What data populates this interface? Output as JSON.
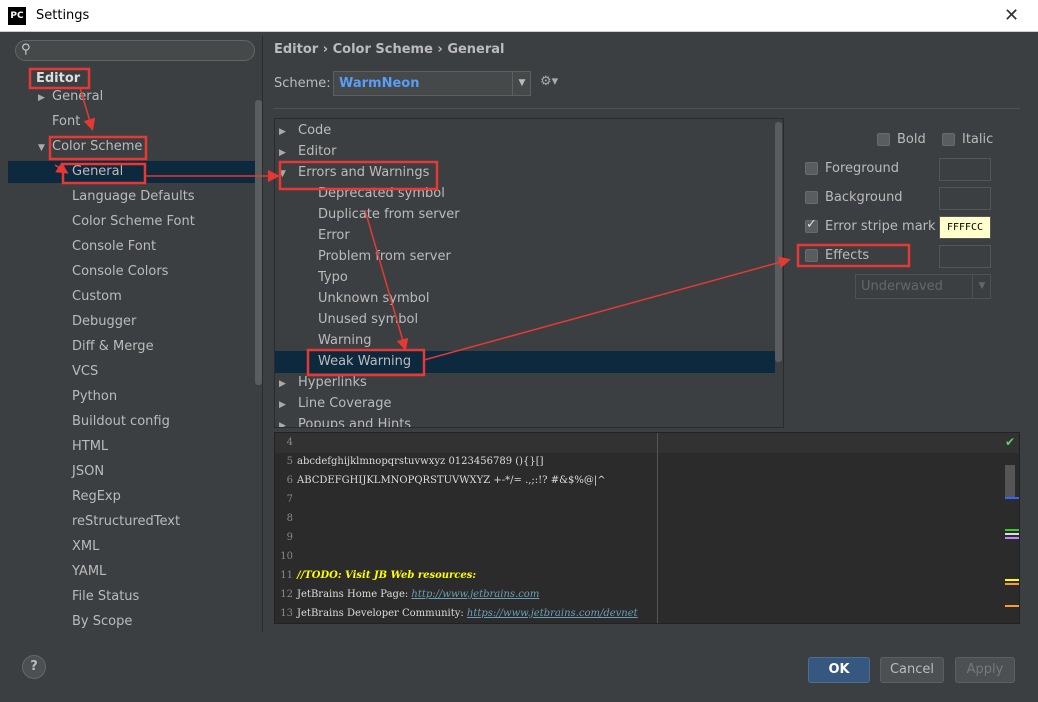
{
  "window": {
    "title": "Settings",
    "logo": "PC",
    "close": "✕"
  },
  "search": {
    "placeholder": "",
    "icon": "search-icon"
  },
  "sidebar": {
    "root": "Editor",
    "items": [
      {
        "label": "General",
        "arrow": "▶",
        "level": 1
      },
      {
        "label": "Font",
        "arrow": "",
        "level": 1
      },
      {
        "label": "Color Scheme",
        "arrow": "▼",
        "level": 1
      },
      {
        "label": "General",
        "arrow": "",
        "level": 2,
        "selected": true
      },
      {
        "label": "Language Defaults",
        "level": 2
      },
      {
        "label": "Color Scheme Font",
        "level": 2
      },
      {
        "label": "Console Font",
        "level": 2
      },
      {
        "label": "Console Colors",
        "level": 2
      },
      {
        "label": "Custom",
        "level": 2
      },
      {
        "label": "Debugger",
        "level": 2
      },
      {
        "label": "Diff & Merge",
        "level": 2
      },
      {
        "label": "VCS",
        "level": 2
      },
      {
        "label": "Python",
        "level": 2
      },
      {
        "label": "Buildout config",
        "level": 2
      },
      {
        "label": "HTML",
        "level": 2
      },
      {
        "label": "JSON",
        "level": 2
      },
      {
        "label": "RegExp",
        "level": 2
      },
      {
        "label": "reStructuredText",
        "level": 2
      },
      {
        "label": "XML",
        "level": 2
      },
      {
        "label": "YAML",
        "level": 2
      },
      {
        "label": "File Status",
        "level": 2
      },
      {
        "label": "By Scope",
        "level": 2
      }
    ]
  },
  "breadcrumb": "Editor › Color Scheme › General",
  "scheme": {
    "label": "Scheme:",
    "value": "WarmNeon"
  },
  "attributes": [
    {
      "label": "Code",
      "arrow": "▶",
      "level": 0
    },
    {
      "label": "Editor",
      "arrow": "▶",
      "level": 0
    },
    {
      "label": "Errors and Warnings",
      "arrow": "▼",
      "level": 0
    },
    {
      "label": "Deprecated symbol",
      "level": 1
    },
    {
      "label": "Duplicate from server",
      "level": 1
    },
    {
      "label": "Error",
      "level": 1
    },
    {
      "label": "Problem from server",
      "level": 1
    },
    {
      "label": "Typo",
      "level": 1
    },
    {
      "label": "Unknown symbol",
      "level": 1
    },
    {
      "label": "Unused symbol",
      "level": 1
    },
    {
      "label": "Warning",
      "level": 1
    },
    {
      "label": "Weak Warning",
      "level": 1,
      "selected": true
    },
    {
      "label": "Hyperlinks",
      "arrow": "▶",
      "level": 0
    },
    {
      "label": "Line Coverage",
      "arrow": "▶",
      "level": 0
    },
    {
      "label": "Popups and Hints",
      "arrow": "▶",
      "level": 0
    }
  ],
  "options": {
    "bold": "Bold",
    "italic": "Italic",
    "foreground": "Foreground",
    "background": "Background",
    "error_stripe": "Error stripe mark",
    "error_stripe_value": "FFFFCC",
    "error_stripe_checked": true,
    "effects": "Effects",
    "effect_type": "Underwaved"
  },
  "preview": [
    {
      "n": "4",
      "t": ""
    },
    {
      "n": "5",
      "t": "abcdefghijklmnopqrstuvwxyz 0123456789 (){}[]"
    },
    {
      "n": "6",
      "t": "ABCDEFGHIJKLMNOPQRSTUVWXYZ +-*/= .,;:!? #&$%@|^"
    },
    {
      "n": "7",
      "t": ""
    },
    {
      "n": "8",
      "t": ""
    },
    {
      "n": "9",
      "t": ""
    },
    {
      "n": "10",
      "t": ""
    },
    {
      "n": "11",
      "t": "//TODO: Visit JB Web resources:",
      "todo": true
    },
    {
      "n": "12",
      "t": "JetBrains Home Page: ",
      "link": "http://www.jetbrains.com"
    },
    {
      "n": "13",
      "t": "JetBrains Developer Community: ",
      "link": "https://www.jetbrains.com/devnet"
    }
  ],
  "buttons": {
    "ok": "OK",
    "cancel": "Cancel",
    "apply": "Apply",
    "help": "?"
  },
  "colors": {
    "annotation": "#e53935",
    "selection": "#0d293e",
    "scheme_value": "#589df6",
    "todo": "#ffff00",
    "link": "#6a9fb5"
  }
}
